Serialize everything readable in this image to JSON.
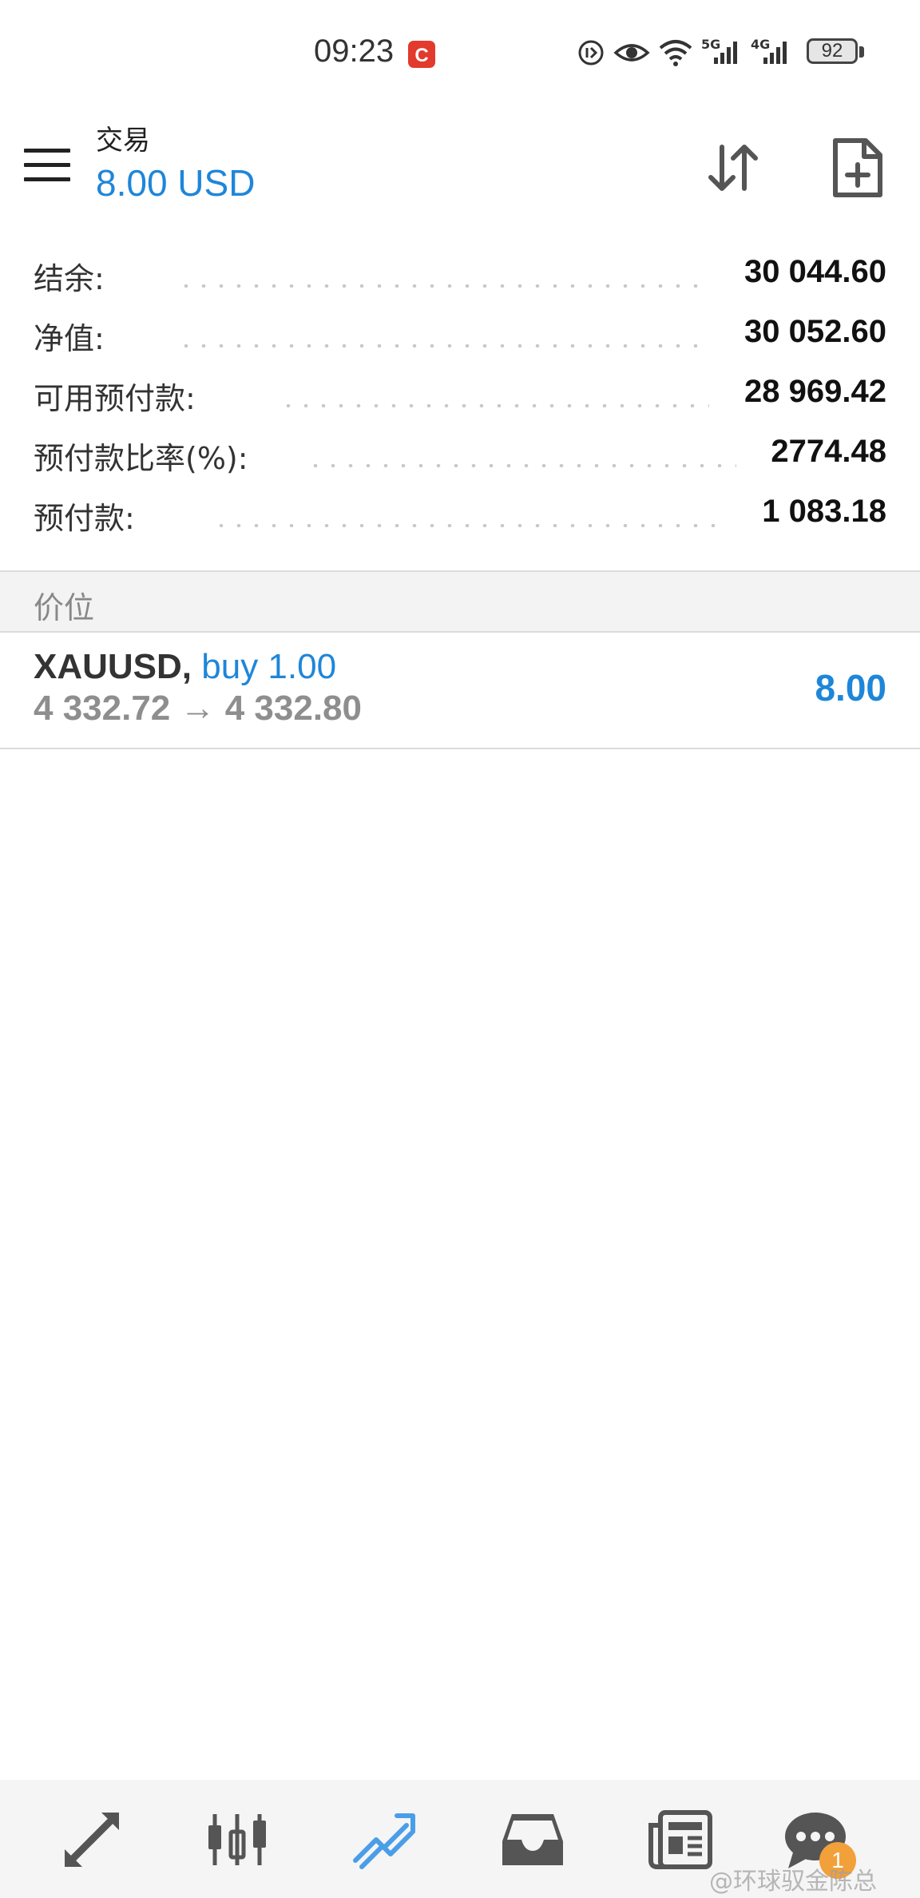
{
  "status_bar": {
    "time": "09:23",
    "network_5g": "5G",
    "network_4g": "4G",
    "battery": "92"
  },
  "header": {
    "title": "交易",
    "subtitle": "8.00 USD"
  },
  "summary": [
    {
      "label": "结余:",
      "value": "30 044.60"
    },
    {
      "label": "净值:",
      "value": "30 052.60"
    },
    {
      "label": "可用预付款:",
      "value": "28 969.42"
    },
    {
      "label": "预付款比率(%):",
      "value": "2774.48"
    },
    {
      "label": "预付款:",
      "value": "1 083.18"
    }
  ],
  "section_label": "价位",
  "position": {
    "symbol": "XAUUSD,",
    "direction": "buy 1.00",
    "prices": "4 332.72 → 4 332.80",
    "profit": "8.00"
  },
  "bottom_nav": {
    "chat_badge": "1",
    "icons": [
      "quotes-icon",
      "chart-candles-icon",
      "trade-icon",
      "history-inbox-icon",
      "news-icon",
      "chat-icon"
    ],
    "active": "trade-icon"
  },
  "watermark": "@环球驭金陈总",
  "colors": {
    "accent": "#1e86d9",
    "active_nav": "#4a9ee8",
    "badge": "#f2a03a"
  }
}
